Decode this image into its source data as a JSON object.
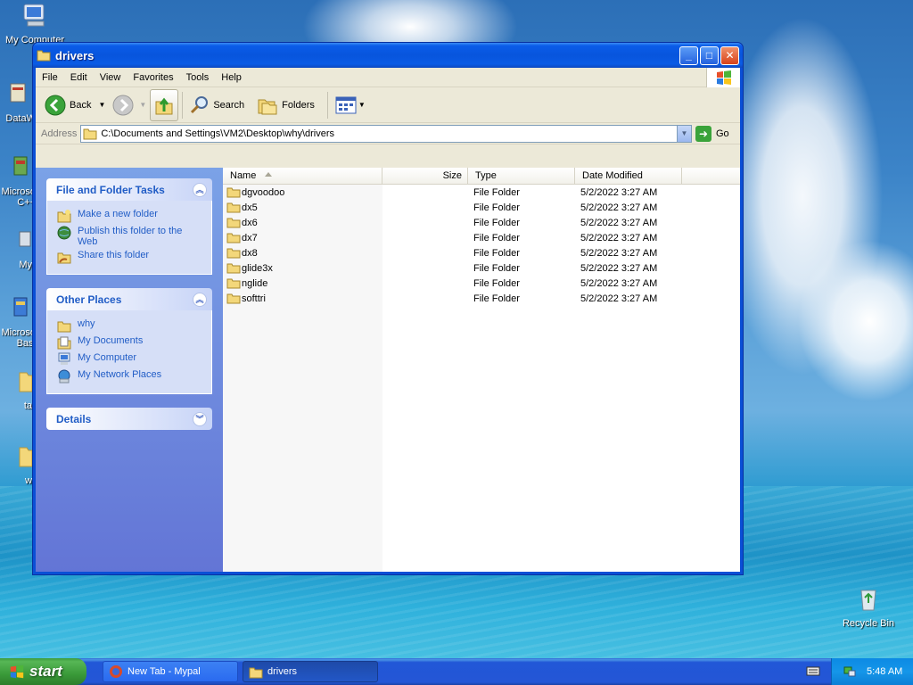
{
  "desktop": {
    "icons": [
      {
        "label": "My Computer"
      },
      {
        "label": "DataW"
      },
      {
        "label": "Microso C++"
      },
      {
        "label": "My"
      },
      {
        "label": "Microso Basi"
      },
      {
        "label": "ta"
      },
      {
        "label": "w"
      },
      {
        "label": "Recycle Bin"
      }
    ]
  },
  "window": {
    "title": "drivers",
    "menu": [
      "File",
      "Edit",
      "View",
      "Favorites",
      "Tools",
      "Help"
    ],
    "toolbar": {
      "back_label": "Back",
      "search_label": "Search",
      "folders_label": "Folders"
    },
    "address": {
      "label": "Address",
      "path": "C:\\Documents and Settings\\VM2\\Desktop\\why\\drivers",
      "go_label": "Go"
    },
    "taskpane": {
      "file_tasks": {
        "title": "File and Folder Tasks",
        "items": [
          "Make a new folder",
          "Publish this folder to the Web",
          "Share this folder"
        ]
      },
      "other_places": {
        "title": "Other Places",
        "items": [
          "why",
          "My Documents",
          "My Computer",
          "My Network Places"
        ]
      },
      "details": {
        "title": "Details"
      }
    },
    "columns": {
      "name": "Name",
      "size": "Size",
      "type": "Type",
      "date": "Date Modified"
    },
    "files": [
      {
        "name": "dgvoodoo",
        "size": "",
        "type": "File Folder",
        "date": "5/2/2022 3:27 AM"
      },
      {
        "name": "dx5",
        "size": "",
        "type": "File Folder",
        "date": "5/2/2022 3:27 AM"
      },
      {
        "name": "dx6",
        "size": "",
        "type": "File Folder",
        "date": "5/2/2022 3:27 AM"
      },
      {
        "name": "dx7",
        "size": "",
        "type": "File Folder",
        "date": "5/2/2022 3:27 AM"
      },
      {
        "name": "dx8",
        "size": "",
        "type": "File Folder",
        "date": "5/2/2022 3:27 AM"
      },
      {
        "name": "glide3x",
        "size": "",
        "type": "File Folder",
        "date": "5/2/2022 3:27 AM"
      },
      {
        "name": "nglide",
        "size": "",
        "type": "File Folder",
        "date": "5/2/2022 3:27 AM"
      },
      {
        "name": "softtri",
        "size": "",
        "type": "File Folder",
        "date": "5/2/2022 3:27 AM"
      }
    ]
  },
  "taskbar": {
    "start_label": "start",
    "tasks": [
      {
        "label": "New Tab - Mypal",
        "icon": "browser-icon",
        "active": false
      },
      {
        "label": "drivers",
        "icon": "folder-icon",
        "active": true
      }
    ],
    "clock": "5:48 AM"
  },
  "colors": {
    "title_blue": "#0a5ce8",
    "taskpane_link": "#215dc6",
    "start_green": "#3a9a39",
    "tray_blue": "#0c8ae4"
  }
}
